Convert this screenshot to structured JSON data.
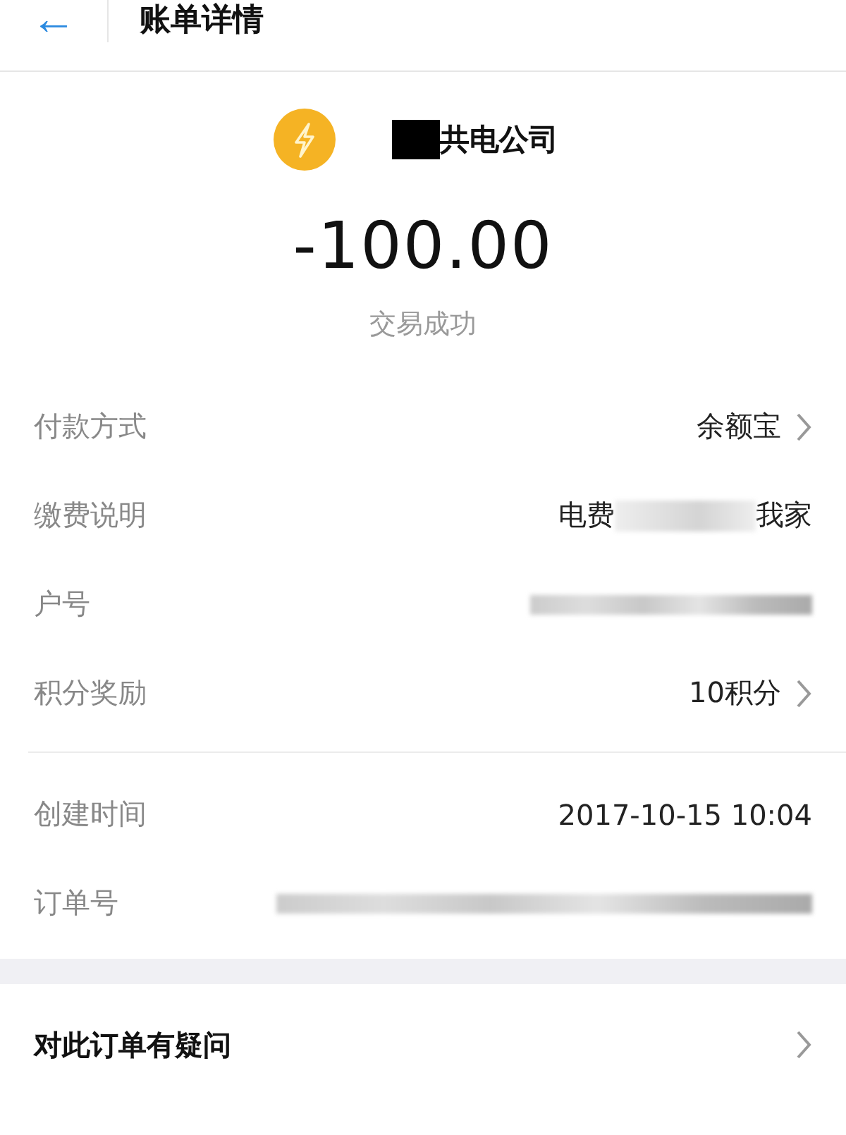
{
  "header": {
    "title": "账单详情",
    "back": "←"
  },
  "merchant": {
    "name": "共电公司",
    "redacted_prefix": true
  },
  "amount": "-100.00",
  "status": "交易成功",
  "sections": [
    {
      "rows": [
        {
          "label": "付款方式",
          "link": true,
          "value": [
            {
              "kind": "text",
              "text": "余额宝"
            }
          ]
        },
        {
          "label": "缴费说明",
          "link": false,
          "value": [
            {
              "kind": "text",
              "text": "电费"
            },
            {
              "kind": "blur"
            },
            {
              "kind": "text",
              "text": "我家"
            }
          ]
        },
        {
          "label": "户号",
          "link": false,
          "value": [
            {
              "kind": "blur"
            }
          ]
        },
        {
          "label": "积分奖励",
          "link": true,
          "value": [
            {
              "kind": "text",
              "text": "10积分"
            }
          ]
        }
      ]
    },
    {
      "rows": [
        {
          "label": "创建时间",
          "link": false,
          "value": [
            {
              "kind": "text",
              "text": "2017-10-15 10:04"
            }
          ]
        },
        {
          "label": "订单号",
          "link": false,
          "value": [
            {
              "kind": "blur",
              "wide": true
            }
          ]
        }
      ]
    }
  ],
  "footer": {
    "label": "对此订单有疑问",
    "link": true
  }
}
